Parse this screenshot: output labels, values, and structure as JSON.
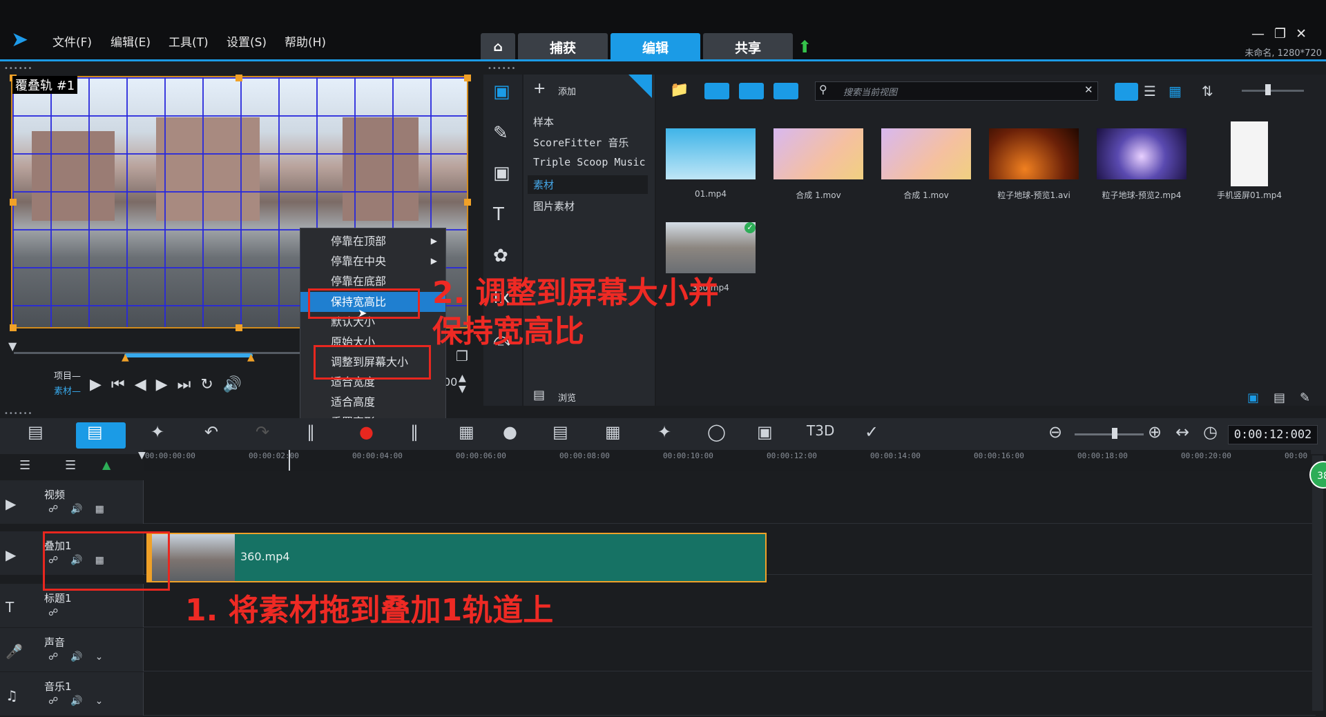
{
  "menu": [
    "文件(F)",
    "编辑(E)",
    "工具(T)",
    "设置(S)",
    "帮助(H)"
  ],
  "tabs": {
    "capture": "捕获",
    "edit": "编辑",
    "share": "共享"
  },
  "project_info": "未命名, 1280*720",
  "preview": {
    "overlay_label": "覆叠轨 #1",
    "project_label": "项目—",
    "clip_label": "素材—",
    "timecode_tail": "00"
  },
  "context_menu": [
    "停靠在顶部",
    "停靠在中央",
    "停靠在底部",
    "保持宽高比",
    "默认大小",
    "原始大小",
    "调整到屏幕大小",
    "适合宽度",
    "适合高度",
    "重置变形"
  ],
  "annotations": {
    "step2_line1": "2. 调整到屏幕大小并",
    "step2_line2": "保持宽高比",
    "step1": "1. 将素材拖到叠加1轨道上"
  },
  "library": {
    "add_label": "添加",
    "nav": [
      "样本",
      "ScoreFitter 音乐",
      "Triple Scoop Music",
      "素材",
      "图片素材"
    ],
    "search_placeholder": "搜索当前视图",
    "browse_label": "浏览",
    "items": [
      "01.mp4",
      "合成 1.mov",
      "合成 1.mov",
      "粒子地球-预览1.avi",
      "粒子地球-预览2.mp4",
      "手机竖屏01.mp4",
      "360.mp4"
    ]
  },
  "timeline": {
    "timecode": "0:00:12:002",
    "ticks": [
      "00:00:00:00",
      "00:00:02:00",
      "00:00:04:00",
      "00:00:06:00",
      "00:00:08:00",
      "00:00:10:00",
      "00:00:12:00",
      "00:00:14:00",
      "00:00:16:00",
      "00:00:18:00",
      "00:00:20:00",
      "00:00"
    ],
    "tracks": [
      "视频",
      "叠加1",
      "标题1",
      "声音",
      "音乐1"
    ],
    "clip_name": "360.mp4",
    "bubble": "38"
  },
  "colors": {
    "accent": "#1b9be6",
    "annotation": "#ee2a24",
    "clip": "#167264"
  }
}
